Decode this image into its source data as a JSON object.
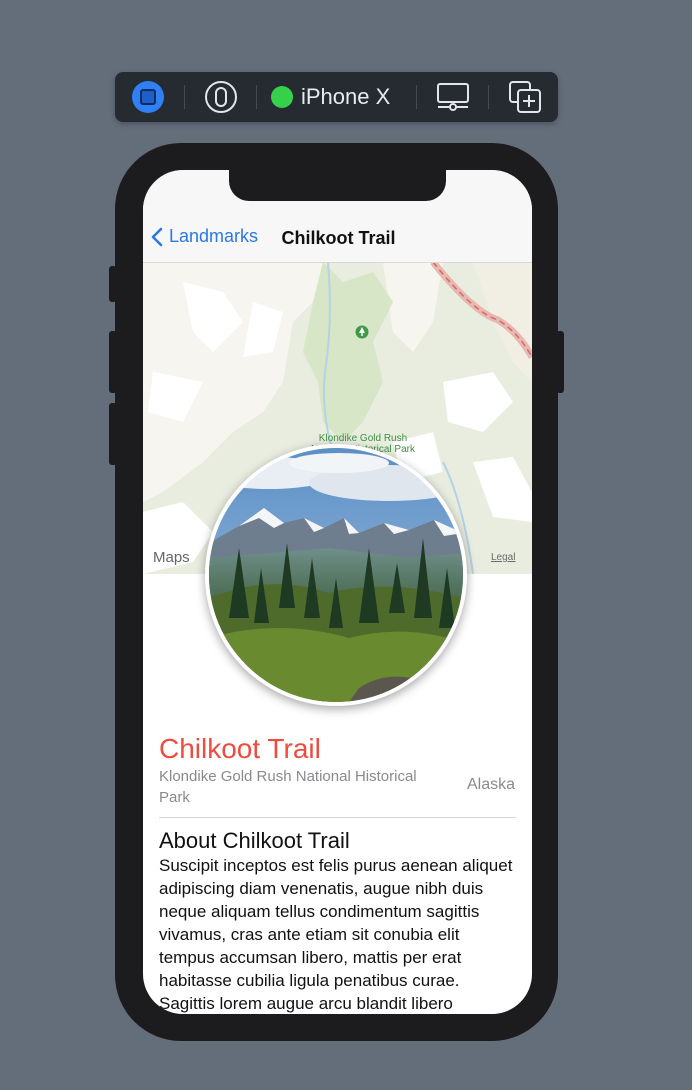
{
  "toolbar": {
    "device_name": "iPhone X",
    "accent_color": "#2f7ff5",
    "status_color": "#36d14a",
    "buttons": [
      "live-preview-icon",
      "pin-icon",
      "device-settings-icon",
      "duplicate-preview-icon"
    ]
  },
  "navbar": {
    "back_label": "Landmarks",
    "title": "Chilkoot Trail"
  },
  "map": {
    "place_label": "Klondike Gold Rush National Historical Park",
    "logo_label": "Maps",
    "legal_label": "Legal"
  },
  "landmark": {
    "name": "Chilkoot Trail",
    "park": "Klondike Gold Rush National Historical Park",
    "state": "Alaska",
    "about_heading": "About Chilkoot Trail",
    "description": "Suscipit inceptos est felis purus aenean aliquet adipiscing diam venenatis, augue nibh duis neque aliquam tellus condimentum sagittis vivamus, cras ante etiam sit conubia elit tempus accumsan libero, mattis per erat habitasse cubilia ligula penatibus curae. Sagittis lorem augue arcu blandit libero",
    "accent_color": "#ef4b3f"
  }
}
